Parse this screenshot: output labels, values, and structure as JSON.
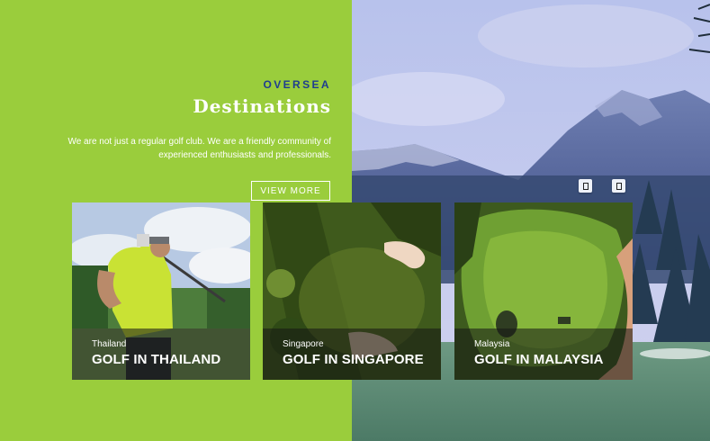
{
  "hero": {
    "eyebrow": "OVERSEA",
    "title": "Destinations",
    "description": "We are not just a regular golf club. We are a friendly community of experienced enthusiasts and professionals.",
    "cta_label": "VIEW MORE"
  },
  "carousel": {
    "prev_icon": "chevron-left-icon",
    "next_icon": "chevron-right-icon"
  },
  "cards": [
    {
      "country": "Thailand",
      "title": "GOLF IN THAILAND"
    },
    {
      "country": "Singapore",
      "title": "GOLF IN SINGAPORE"
    },
    {
      "country": "Malaysia",
      "title": "GOLF IN MALAYSIA"
    }
  ],
  "colors": {
    "panel_green": "#9acd3c",
    "eyebrow_blue": "#1f3d8f",
    "caption_overlay": "rgba(20,22,20,0.55)"
  }
}
